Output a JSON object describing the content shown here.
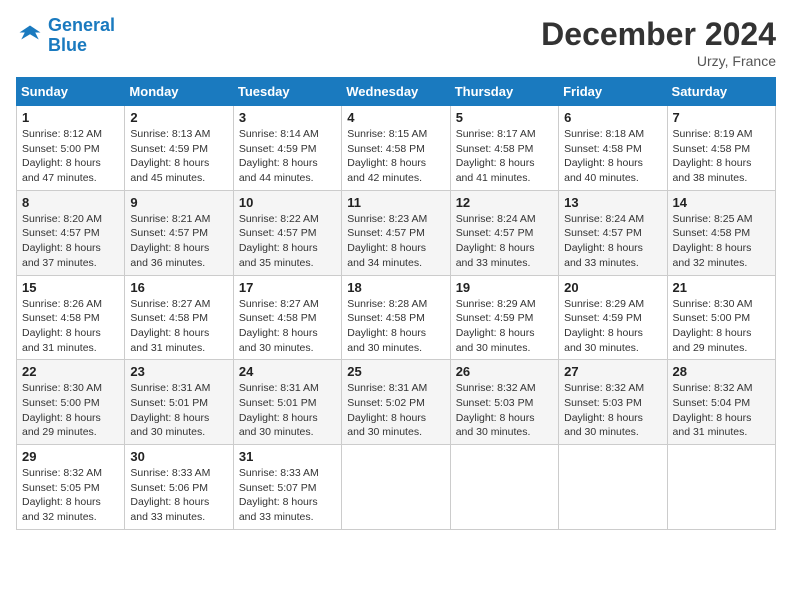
{
  "logo": {
    "line1": "General",
    "line2": "Blue"
  },
  "title": "December 2024",
  "location": "Urzy, France",
  "headers": [
    "Sunday",
    "Monday",
    "Tuesday",
    "Wednesday",
    "Thursday",
    "Friday",
    "Saturday"
  ],
  "weeks": [
    [
      {
        "day": "1",
        "sunrise": "8:12 AM",
        "sunset": "5:00 PM",
        "daylight": "8 hours and 47 minutes."
      },
      {
        "day": "2",
        "sunrise": "8:13 AM",
        "sunset": "4:59 PM",
        "daylight": "8 hours and 45 minutes."
      },
      {
        "day": "3",
        "sunrise": "8:14 AM",
        "sunset": "4:59 PM",
        "daylight": "8 hours and 44 minutes."
      },
      {
        "day": "4",
        "sunrise": "8:15 AM",
        "sunset": "4:58 PM",
        "daylight": "8 hours and 42 minutes."
      },
      {
        "day": "5",
        "sunrise": "8:17 AM",
        "sunset": "4:58 PM",
        "daylight": "8 hours and 41 minutes."
      },
      {
        "day": "6",
        "sunrise": "8:18 AM",
        "sunset": "4:58 PM",
        "daylight": "8 hours and 40 minutes."
      },
      {
        "day": "7",
        "sunrise": "8:19 AM",
        "sunset": "4:58 PM",
        "daylight": "8 hours and 38 minutes."
      }
    ],
    [
      {
        "day": "8",
        "sunrise": "8:20 AM",
        "sunset": "4:57 PM",
        "daylight": "8 hours and 37 minutes."
      },
      {
        "day": "9",
        "sunrise": "8:21 AM",
        "sunset": "4:57 PM",
        "daylight": "8 hours and 36 minutes."
      },
      {
        "day": "10",
        "sunrise": "8:22 AM",
        "sunset": "4:57 PM",
        "daylight": "8 hours and 35 minutes."
      },
      {
        "day": "11",
        "sunrise": "8:23 AM",
        "sunset": "4:57 PM",
        "daylight": "8 hours and 34 minutes."
      },
      {
        "day": "12",
        "sunrise": "8:24 AM",
        "sunset": "4:57 PM",
        "daylight": "8 hours and 33 minutes."
      },
      {
        "day": "13",
        "sunrise": "8:24 AM",
        "sunset": "4:57 PM",
        "daylight": "8 hours and 33 minutes."
      },
      {
        "day": "14",
        "sunrise": "8:25 AM",
        "sunset": "4:58 PM",
        "daylight": "8 hours and 32 minutes."
      }
    ],
    [
      {
        "day": "15",
        "sunrise": "8:26 AM",
        "sunset": "4:58 PM",
        "daylight": "8 hours and 31 minutes."
      },
      {
        "day": "16",
        "sunrise": "8:27 AM",
        "sunset": "4:58 PM",
        "daylight": "8 hours and 31 minutes."
      },
      {
        "day": "17",
        "sunrise": "8:27 AM",
        "sunset": "4:58 PM",
        "daylight": "8 hours and 30 minutes."
      },
      {
        "day": "18",
        "sunrise": "8:28 AM",
        "sunset": "4:58 PM",
        "daylight": "8 hours and 30 minutes."
      },
      {
        "day": "19",
        "sunrise": "8:29 AM",
        "sunset": "4:59 PM",
        "daylight": "8 hours and 30 minutes."
      },
      {
        "day": "20",
        "sunrise": "8:29 AM",
        "sunset": "4:59 PM",
        "daylight": "8 hours and 30 minutes."
      },
      {
        "day": "21",
        "sunrise": "8:30 AM",
        "sunset": "5:00 PM",
        "daylight": "8 hours and 29 minutes."
      }
    ],
    [
      {
        "day": "22",
        "sunrise": "8:30 AM",
        "sunset": "5:00 PM",
        "daylight": "8 hours and 29 minutes."
      },
      {
        "day": "23",
        "sunrise": "8:31 AM",
        "sunset": "5:01 PM",
        "daylight": "8 hours and 30 minutes."
      },
      {
        "day": "24",
        "sunrise": "8:31 AM",
        "sunset": "5:01 PM",
        "daylight": "8 hours and 30 minutes."
      },
      {
        "day": "25",
        "sunrise": "8:31 AM",
        "sunset": "5:02 PM",
        "daylight": "8 hours and 30 minutes."
      },
      {
        "day": "26",
        "sunrise": "8:32 AM",
        "sunset": "5:03 PM",
        "daylight": "8 hours and 30 minutes."
      },
      {
        "day": "27",
        "sunrise": "8:32 AM",
        "sunset": "5:03 PM",
        "daylight": "8 hours and 30 minutes."
      },
      {
        "day": "28",
        "sunrise": "8:32 AM",
        "sunset": "5:04 PM",
        "daylight": "8 hours and 31 minutes."
      }
    ],
    [
      {
        "day": "29",
        "sunrise": "8:32 AM",
        "sunset": "5:05 PM",
        "daylight": "8 hours and 32 minutes."
      },
      {
        "day": "30",
        "sunrise": "8:33 AM",
        "sunset": "5:06 PM",
        "daylight": "8 hours and 33 minutes."
      },
      {
        "day": "31",
        "sunrise": "8:33 AM",
        "sunset": "5:07 PM",
        "daylight": "8 hours and 33 minutes."
      },
      null,
      null,
      null,
      null
    ]
  ],
  "labels": {
    "sunrise": "Sunrise:",
    "sunset": "Sunset:",
    "daylight": "Daylight:"
  }
}
